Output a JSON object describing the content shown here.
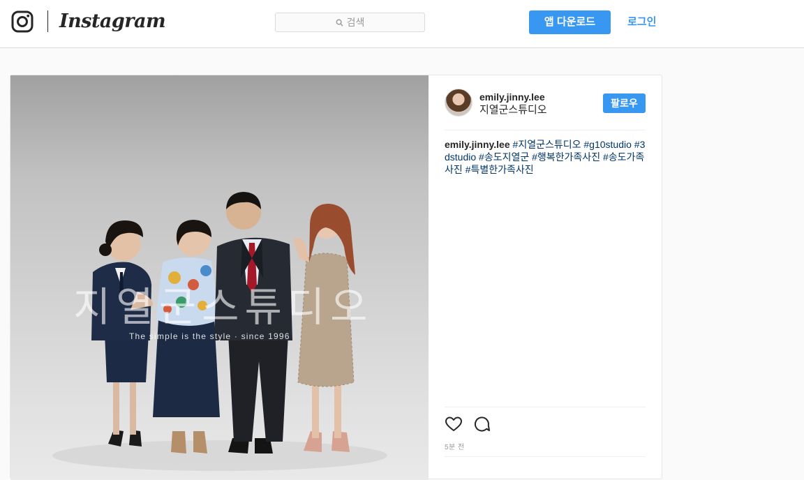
{
  "header": {
    "wordmark": "Instagram",
    "search_placeholder": "검색",
    "app_download_label": "앱 다운로드",
    "login_label": "로그인",
    "icons": {
      "logo": "instagram-glyph-icon",
      "search": "search-icon"
    }
  },
  "post": {
    "author": {
      "username": "emily.jinny.lee",
      "location": "지열군스튜디오",
      "follow_label": "팔로우"
    },
    "photo": {
      "watermark_title": "지열군스튜디오",
      "watermark_tagline": "The simple is the style · since 1996"
    },
    "caption": {
      "username": "emily.jinny.lee",
      "hashtags": [
        "#지열군스튜디오",
        "#g10studio",
        "#3dstudio",
        "#송도지열군",
        "#행복한가족사진",
        "#송도가족사진",
        "#특별한가족사진"
      ]
    },
    "actions": {
      "like_icon": "heart-icon",
      "comment_icon": "comment-icon"
    },
    "timestamp": "5분 전"
  },
  "colors": {
    "accent": "#3897f0",
    "hashtag": "#003569",
    "text": "#262626",
    "muted": "#999999",
    "border": "#dbdbdb",
    "page_background": "#fafafa"
  }
}
